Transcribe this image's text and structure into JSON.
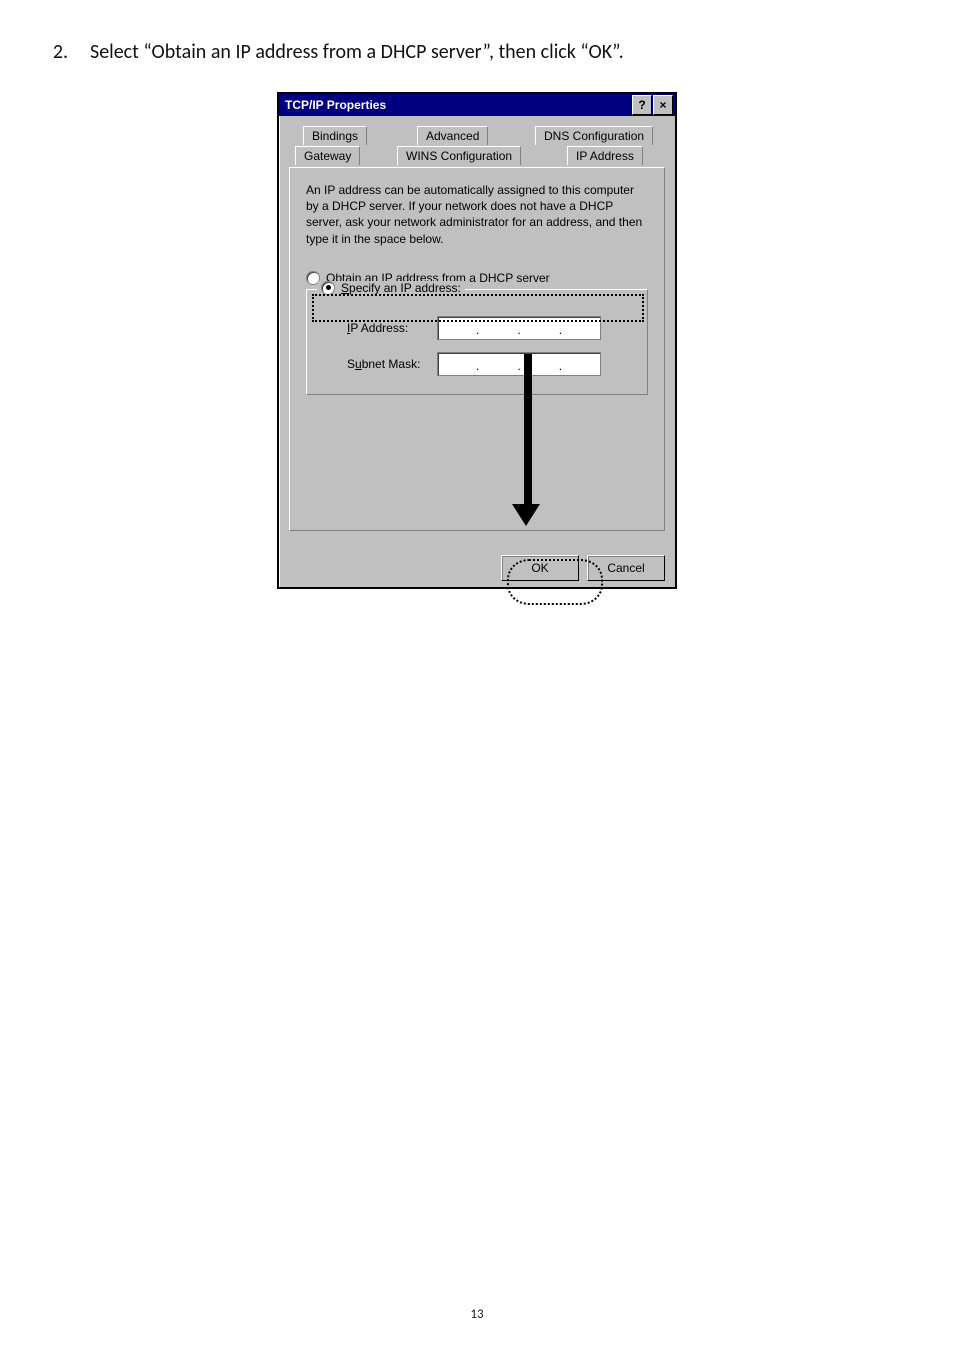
{
  "instruction": {
    "number": "2.",
    "text": "Select “Obtain an IP address from a DHCP server”, then click “OK”."
  },
  "dialog": {
    "title": "TCP/IP Properties",
    "help_glyph": "?",
    "close_glyph": "×",
    "tabs": {
      "back": {
        "bindings": "Bindings",
        "advanced": "Advanced",
        "dns": "DNS Configuration"
      },
      "front": {
        "gateway": "Gateway",
        "wins": "WINS Configuration",
        "ip": "IP Address"
      }
    },
    "description": "An IP address can be automatically assigned to this computer by a DHCP server. If your network does not have a DHCP server, ask your network administrator for an address, and then type it in the space below.",
    "radio": {
      "obtain_pre": "O",
      "obtain_rest": "btain an IP address from a DHCP server",
      "specify_pre": "S",
      "specify_rest": "pecify an IP address:"
    },
    "fields": {
      "ip_label_pre": "I",
      "ip_label_rest": "P Address:",
      "mask_label_pre": "u",
      "mask_label_before": "S",
      "mask_label_after": "bnet Mask:"
    },
    "buttons": {
      "ok": "OK",
      "cancel": "Cancel"
    }
  },
  "page_number": "13"
}
